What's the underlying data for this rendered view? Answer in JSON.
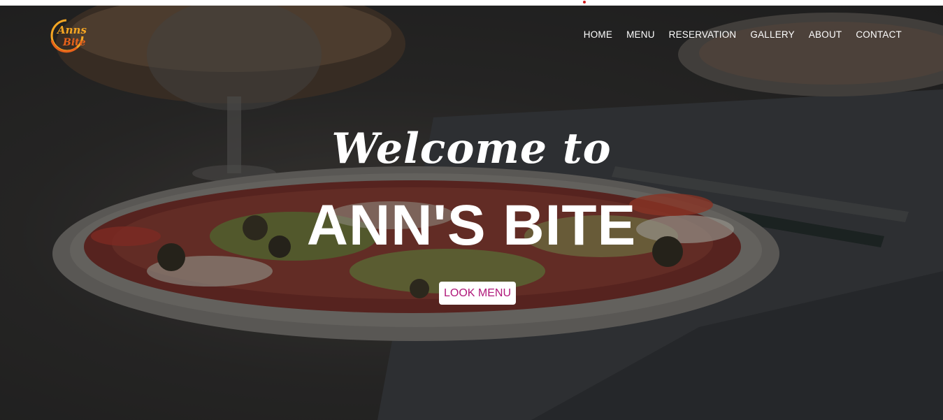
{
  "nav": {
    "items": [
      {
        "label": "HOME"
      },
      {
        "label": "MENU"
      },
      {
        "label": "RESERVATION"
      },
      {
        "label": "GALLERY"
      },
      {
        "label": "ABOUT"
      },
      {
        "label": "CONTACT"
      }
    ]
  },
  "logo": {
    "text_line1": "Anns",
    "text_line2": "Bite",
    "colors": {
      "ring": "#f5a623",
      "text": "#e8621a"
    }
  },
  "hero": {
    "welcome": "Welcome to",
    "brand": "ANN'S BITE",
    "cta_label": "LOOK MENU",
    "cta_color": "#b0187a"
  }
}
